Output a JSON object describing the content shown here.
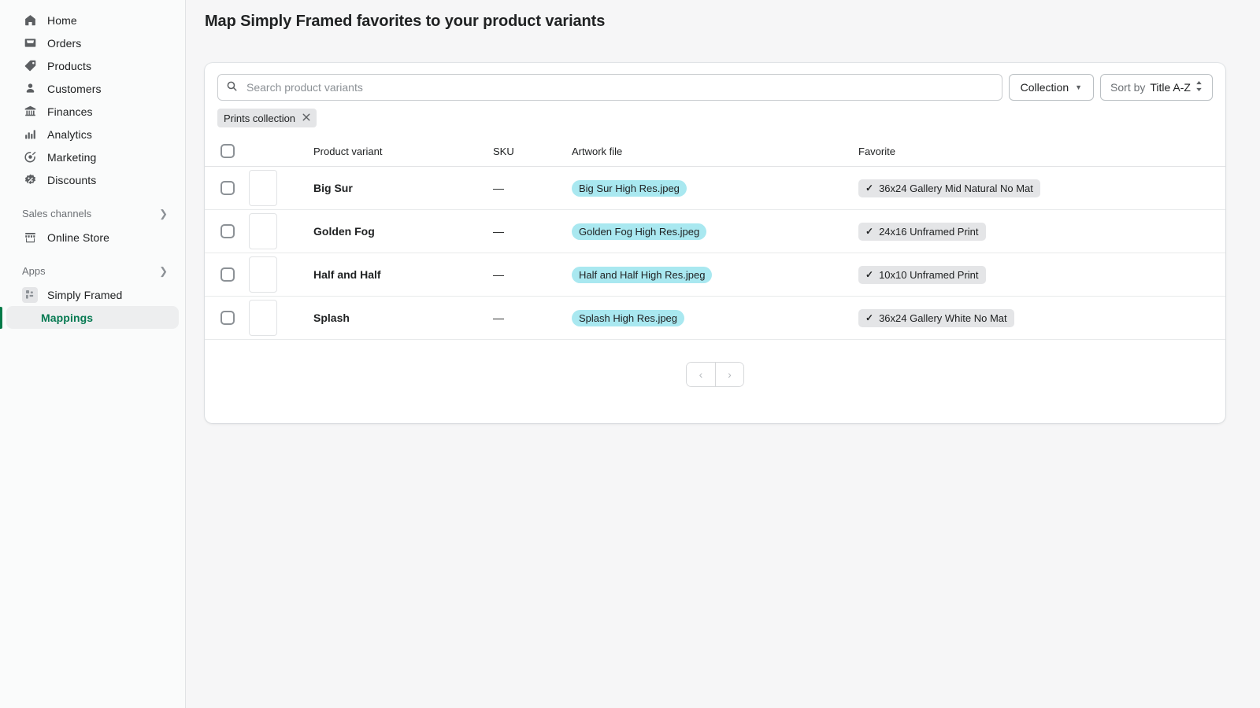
{
  "sidebar": {
    "primary_items": [
      {
        "label": "Home",
        "icon": "home-icon"
      },
      {
        "label": "Orders",
        "icon": "orders-inbox-icon"
      },
      {
        "label": "Products",
        "icon": "products-tag-icon"
      },
      {
        "label": "Customers",
        "icon": "customers-person-icon"
      },
      {
        "label": "Finances",
        "icon": "finances-bank-icon"
      },
      {
        "label": "Analytics",
        "icon": "analytics-bars-icon"
      },
      {
        "label": "Marketing",
        "icon": "marketing-target-icon"
      },
      {
        "label": "Discounts",
        "icon": "discounts-percent-icon"
      }
    ],
    "sales_channels": {
      "label": "Sales channels",
      "items": [
        {
          "label": "Online Store",
          "icon": "storefront-icon"
        }
      ]
    },
    "apps": {
      "label": "Apps",
      "items": [
        {
          "label": "Simply Framed",
          "icon": "app-blocks-icon"
        }
      ]
    },
    "active_child": {
      "label": "Mappings"
    },
    "accent_color": "#067a52"
  },
  "page": {
    "title": "Map Simply Framed favorites to your product variants"
  },
  "search": {
    "placeholder": "Search product variants",
    "value": ""
  },
  "toolbar": {
    "collection_label": "Collection",
    "collection_caret": "▾",
    "sort_prefix": "Sort by",
    "sort_value": "Title A-Z",
    "sort_updown": "⬍"
  },
  "filters": {
    "chips": [
      {
        "label": "Prints collection",
        "remove": "✕"
      }
    ]
  },
  "table": {
    "columns": [
      "",
      "",
      "Product variant",
      "SKU",
      "Artwork file",
      "Favorite"
    ],
    "headers": {
      "product_variant": "Product variant",
      "sku": "SKU",
      "artwork_file": "Artwork file",
      "favorite": "Favorite"
    },
    "rows": [
      {
        "name": "Big Sur",
        "sku": "—",
        "artwork_file": "Big Sur High Res.jpeg",
        "favorite": "36x24 Gallery Mid Natural No Mat",
        "favorite_tick": "✓",
        "thumb_class": "t-bigsur"
      },
      {
        "name": "Golden Fog",
        "sku": "—",
        "artwork_file": "Golden Fog High Res.jpeg",
        "favorite": "24x16 Unframed Print",
        "favorite_tick": "✓",
        "thumb_class": "t-golden"
      },
      {
        "name": "Half and Half",
        "sku": "—",
        "artwork_file": "Half and Half High Res.jpeg",
        "favorite": "10x10 Unframed Print",
        "favorite_tick": "✓",
        "thumb_class": "t-half"
      },
      {
        "name": "Splash",
        "sku": "—",
        "artwork_file": "Splash High Res.jpeg",
        "favorite": "36x24 Gallery White No Mat",
        "favorite_tick": "✓",
        "thumb_class": "t-splash"
      }
    ]
  },
  "pagination": {
    "prev": "‹",
    "next": "›"
  },
  "colors": {
    "artwork_pill": "#a9e8f0",
    "favorite_pill": "#e4e5e7",
    "page_bg": "#f6f6f7",
    "sidebar_bg": "#fafbfb"
  }
}
